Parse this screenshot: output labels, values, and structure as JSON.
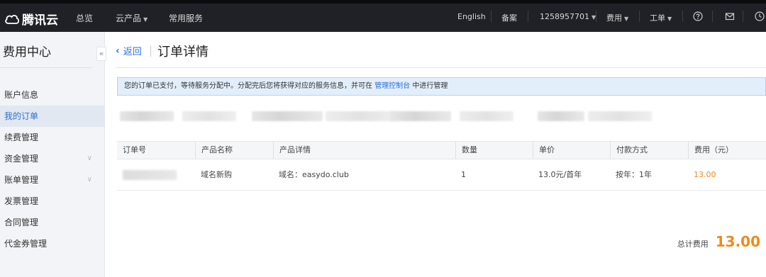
{
  "topbar": {
    "logo": "腾讯云",
    "nav": [
      "总览",
      "云产品",
      "常用服务"
    ],
    "right": {
      "lang": "English",
      "beian": "备案",
      "account": "1258957701",
      "fee": "费用",
      "ticket": "工单"
    },
    "icons": [
      "help-icon",
      "mail-icon",
      "clock-icon"
    ]
  },
  "sidebar": {
    "title": "费用中心",
    "collapse": "«",
    "items": [
      {
        "label": "账户信息",
        "active": false,
        "expandable": false
      },
      {
        "label": "我的订单",
        "active": true,
        "expandable": false
      },
      {
        "label": "续费管理",
        "active": false,
        "expandable": false
      },
      {
        "label": "资金管理",
        "active": false,
        "expandable": true
      },
      {
        "label": "账单管理",
        "active": false,
        "expandable": true
      },
      {
        "label": "发票管理",
        "active": false,
        "expandable": false
      },
      {
        "label": "合同管理",
        "active": false,
        "expandable": false
      },
      {
        "label": "代金券管理",
        "active": false,
        "expandable": false
      }
    ]
  },
  "main": {
    "back": "返回",
    "title": "订单详情",
    "notice": {
      "text_before": "您的订单已支付，等待服务分配中。分配完后您将获得对应的服务信息，并可在",
      "link": "管理控制台",
      "text_after": "中进行管理"
    },
    "table": {
      "headers": [
        "订单号",
        "产品名称",
        "产品详情",
        "数量",
        "单价",
        "付款方式",
        "费用（元）"
      ],
      "rows": [
        {
          "order_no": "",
          "product": "域名新购",
          "detail": "域名：easydo.club",
          "qty": "1",
          "unit_price": "13.0元/首年",
          "pay": "按年：1年",
          "fee": "13.00"
        }
      ]
    },
    "total_label": "总计费用",
    "total_value": "13.00"
  },
  "colors": {
    "topbar_bg": "#1f2126",
    "accent_blue": "#2b6fd8",
    "price_orange": "#f08a1c",
    "notice_bg": "#e3eefb"
  }
}
